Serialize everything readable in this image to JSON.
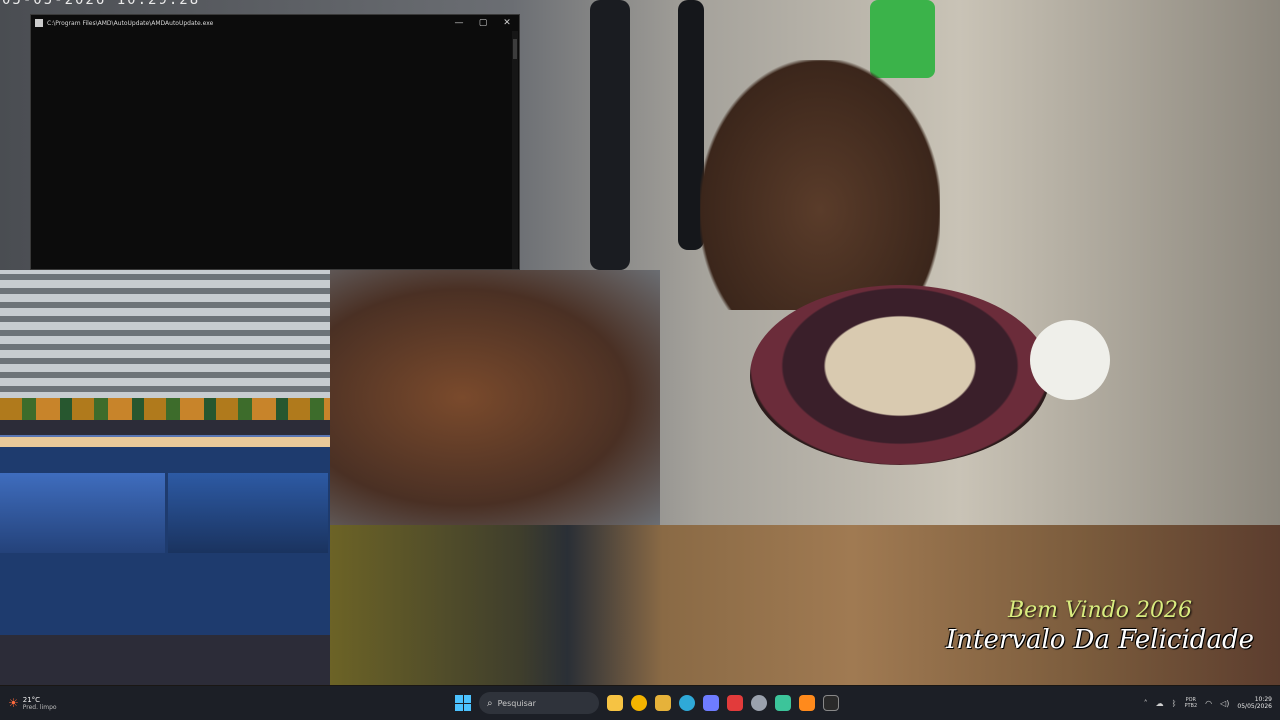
{
  "overlay": {
    "timestamp": "05-05-2026 10:29:28",
    "welcome": "Bem Vindo 2026",
    "happiness": "Intervalo Da Felicidade"
  },
  "console": {
    "title": "C:\\Program Files\\AMD\\AutoUpdate\\AMDAutoUpdate.exe",
    "minimize_glyph": "—",
    "maximize_glyph": "▢",
    "close_glyph": "✕"
  },
  "taskbar": {
    "weather_temp": "21°C",
    "weather_desc": "Pred. limpo",
    "search_placeholder": "Pesquisar",
    "lang_code": "POR",
    "lang_layout": "PTB2",
    "clock_time": "10:29",
    "clock_date": "05/05/2026",
    "colors": {
      "start_accent": "#4cc2ff",
      "chrome": "#f4b400",
      "explorer": "#f6c343",
      "edge": "#2fa9d8",
      "store": "#6e7cff",
      "red_app": "#e23b3b",
      "green_app": "#3cc49a",
      "orange_app": "#ff8a1c"
    }
  }
}
